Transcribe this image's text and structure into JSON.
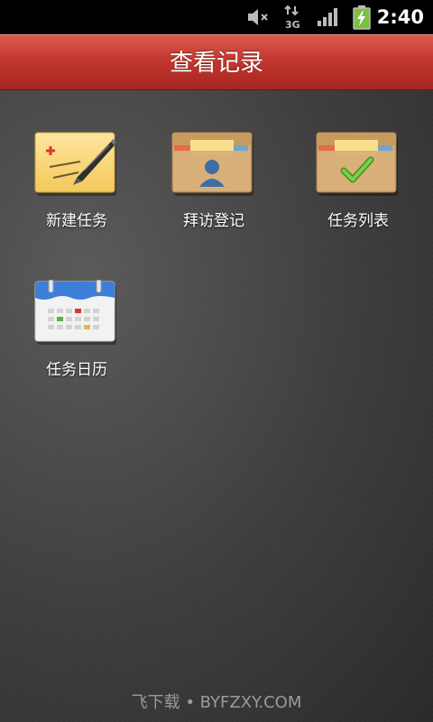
{
  "status_bar": {
    "time": "2:40",
    "network": "3G",
    "icons": [
      "mute-icon",
      "data-3g-icon",
      "signal-icon",
      "battery-charging-icon"
    ]
  },
  "header": {
    "title": "查看记录"
  },
  "menu": {
    "items": [
      {
        "label": "新建任务",
        "icon": "new-task-icon"
      },
      {
        "label": "拜访登记",
        "icon": "visit-register-icon"
      },
      {
        "label": "任务列表",
        "icon": "task-list-icon"
      },
      {
        "label": "任务日历",
        "icon": "task-calendar-icon"
      }
    ]
  },
  "footer": {
    "watermark": "飞下载 • BYFZXY.COM"
  },
  "colors": {
    "title_bar": "#c2382f",
    "background": "#3d3d3d",
    "accent_green": "#5fb336",
    "calendar_blue": "#3d7fd8"
  }
}
